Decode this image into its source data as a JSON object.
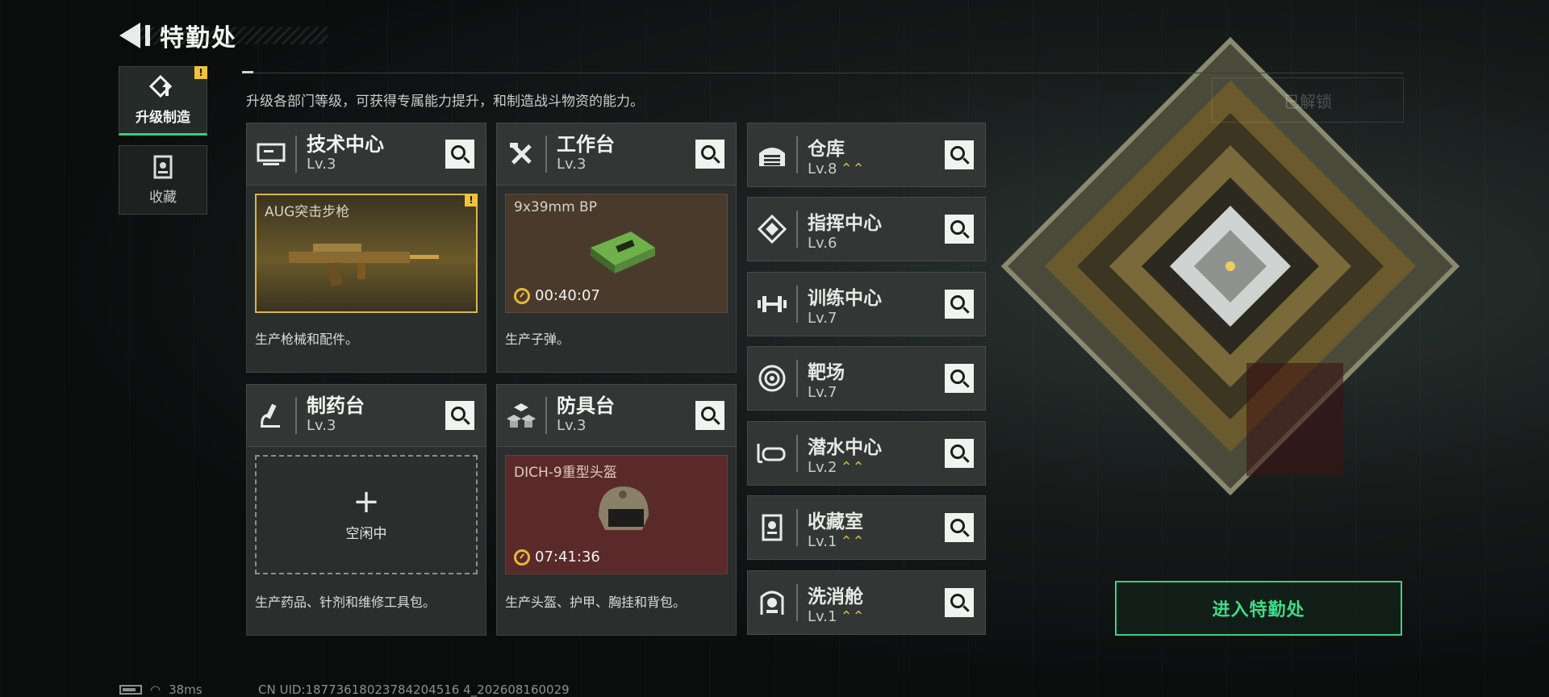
{
  "header": {
    "title": "特勤处",
    "description": "升级各部门等级，可获得专属能力提升，和制造战斗物资的能力。"
  },
  "left_tabs": [
    {
      "label": "升级制造",
      "active": true,
      "icon": "upgrade-icon",
      "warning": "!"
    },
    {
      "label": "收藏",
      "active": false,
      "icon": "collection-icon"
    }
  ],
  "cards": [
    {
      "name": "技术中心",
      "level": "Lv.3",
      "icon": "monitor-icon",
      "slot": {
        "title": "AUG突击步枪",
        "warning": "!",
        "state": "ready"
      },
      "description": "生产枪械和配件。"
    },
    {
      "name": "工作台",
      "level": "Lv.3",
      "icon": "tools-icon",
      "slot": {
        "title": "9x39mm BP",
        "timer": "00:40:07",
        "state": "producing"
      },
      "description": "生产子弹。"
    },
    {
      "name": "制药台",
      "level": "Lv.3",
      "icon": "microscope-icon",
      "slot": {
        "idle_label": "空闲中",
        "state": "idle"
      },
      "description": "生产药品、针剂和维修工具包。"
    },
    {
      "name": "防具台",
      "level": "Lv.3",
      "icon": "armor-icon",
      "slot": {
        "title": "DICH-9重型头盔",
        "timer": "07:41:36",
        "state": "producing"
      },
      "description": "生产头盔、护甲、胸挂和背包。"
    }
  ],
  "side_cards": [
    {
      "name": "仓库",
      "level": "Lv.8",
      "upgradable": true,
      "icon": "warehouse-icon"
    },
    {
      "name": "指挥中心",
      "level": "Lv.6",
      "upgradable": false,
      "icon": "command-icon"
    },
    {
      "name": "训练中心",
      "level": "Lv.7",
      "upgradable": false,
      "icon": "dumbbell-icon"
    },
    {
      "name": "靶场",
      "level": "Lv.7",
      "upgradable": false,
      "icon": "target-icon"
    },
    {
      "name": "潜水中心",
      "level": "Lv.2",
      "upgradable": true,
      "icon": "diving-mask-icon"
    },
    {
      "name": "收藏室",
      "level": "Lv.1",
      "upgradable": true,
      "icon": "display-case-icon"
    },
    {
      "name": "洗消舱",
      "level": "Lv.1",
      "upgradable": true,
      "icon": "decontamination-icon"
    }
  ],
  "upgrade_glyph": "⌃⌃",
  "buttons": {
    "enter": "进入特勤处",
    "ghost": "已解锁"
  },
  "status_bar": {
    "ping": "38ms",
    "uid": "CN UID:18773618023784204516 4_202608160029"
  },
  "colors": {
    "accent_green": "#3ddc86",
    "gold": "#d9b64a",
    "warning": "#f0c33a"
  }
}
